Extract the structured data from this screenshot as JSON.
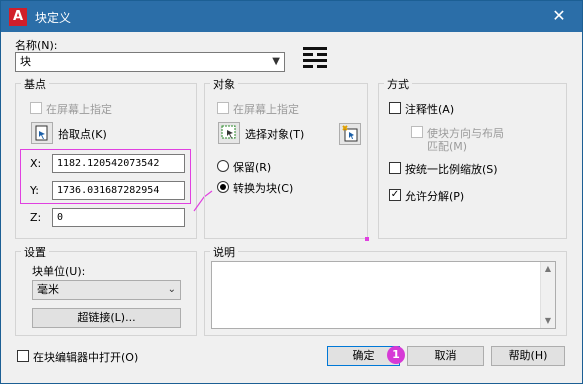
{
  "window": {
    "app_icon_letter": "A",
    "title": "块定义",
    "close_glyph": "✕"
  },
  "name_field": {
    "label": "名称(N):",
    "value": "块"
  },
  "base_point": {
    "group_title": "基点",
    "on_screen_label": "在屏幕上指定",
    "on_screen_checked": false,
    "pick_point_label": "拾取点(K)",
    "x_label": "X:",
    "x_value": "1182.120542073542",
    "y_label": "Y:",
    "y_value": "1736.031687282954",
    "z_label": "Z:",
    "z_value": "0"
  },
  "objects": {
    "group_title": "对象",
    "on_screen_label": "在屏幕上指定",
    "select_objects_label": "选择对象(T)",
    "retain_label": "保留(R)",
    "convert_label": "转换为块(C)",
    "selected_option": "convert"
  },
  "behavior": {
    "group_title": "方式",
    "annotative_label": "注释性(A)",
    "annotative_checked": false,
    "match_orientation_label_line1": "使块方向与布局",
    "match_orientation_label_line2": "匹配(M)",
    "scale_uniformly_label": "按统一比例缩放(S)",
    "scale_uniformly_checked": false,
    "allow_explode_label": "允许分解(P)",
    "allow_explode_checked": true
  },
  "settings": {
    "group_title": "设置",
    "block_unit_label": "块单位(U):",
    "block_unit_value": "毫米",
    "hyperlink_label": "超链接(L)..."
  },
  "description": {
    "group_title": "说明",
    "value": ""
  },
  "footer": {
    "open_in_editor_label": "在块编辑器中打开(O)",
    "open_in_editor_checked": false,
    "ok_label": "确定",
    "cancel_label": "取消",
    "help_label": "帮助(H)",
    "badge_number": "1"
  },
  "colors": {
    "titlebar": "#2b6ea8",
    "highlight": "#e040e0",
    "app_icon": "#d11f2a"
  }
}
